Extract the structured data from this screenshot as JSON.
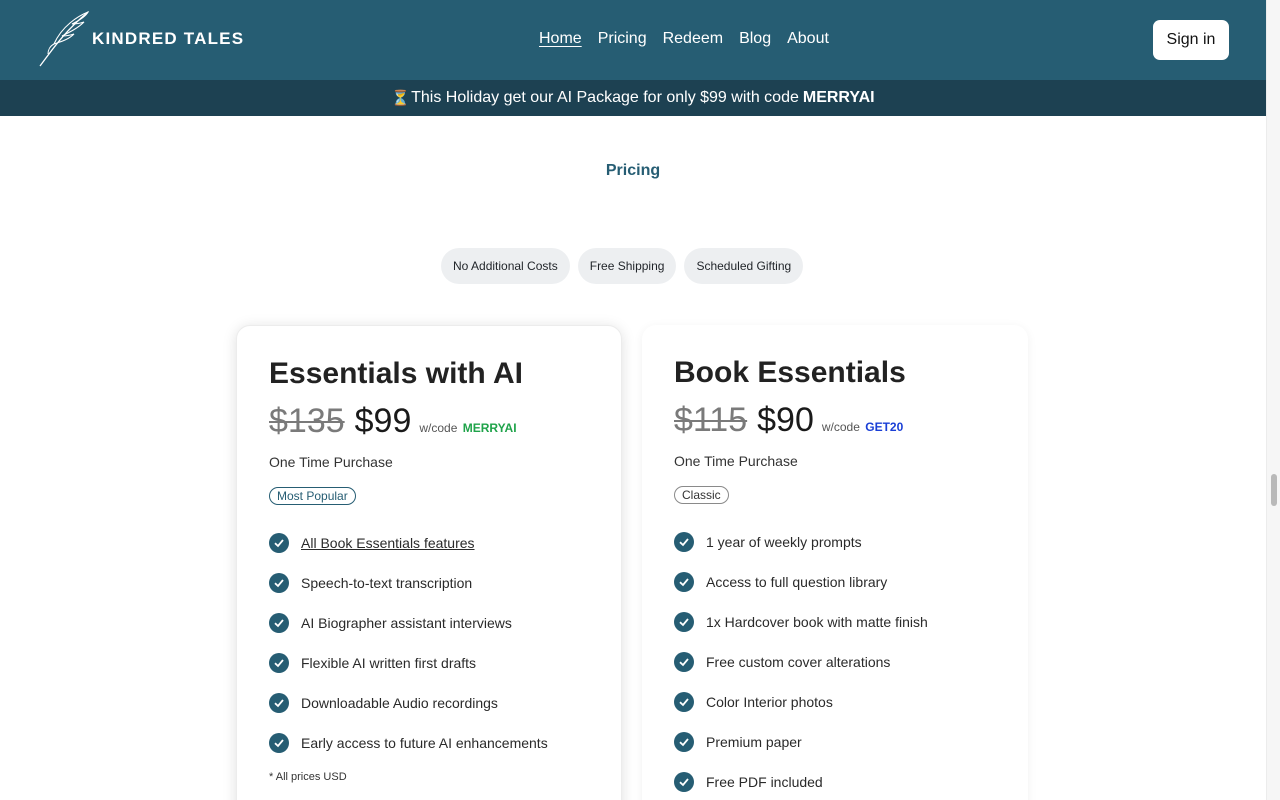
{
  "header": {
    "brand": "KINDRED TALES",
    "nav": [
      {
        "label": "Home",
        "active": true
      },
      {
        "label": "Pricing",
        "active": false
      },
      {
        "label": "Redeem",
        "active": false
      },
      {
        "label": "Blog",
        "active": false
      },
      {
        "label": "About",
        "active": false
      }
    ],
    "signin_label": "Sign in"
  },
  "promo": {
    "icon": "hourglass-icon",
    "text": "This Holiday get our AI Package for only $99 with code",
    "code": "MERRYAI"
  },
  "section_title": "Pricing",
  "chips": [
    "No Additional Costs",
    "Free Shipping",
    "Scheduled Gifting"
  ],
  "plans": [
    {
      "title": "Essentials with AI",
      "old_price": "$135",
      "new_price": "$99",
      "code_prefix": "w/code",
      "code": "MERRYAI",
      "code_color": "#1fa34a",
      "purchase_type": "One Time Purchase",
      "badge": "Most Popular",
      "features": [
        "All Book Essentials features",
        "Speech-to-text transcription",
        "AI Biographer assistant interviews",
        "Flexible AI written first drafts",
        "Downloadable Audio recordings",
        "Early access to future AI enhancements"
      ],
      "note": "* All prices USD"
    },
    {
      "title": "Book Essentials",
      "old_price": "$115",
      "new_price": "$90",
      "code_prefix": "w/code",
      "code": "GET20",
      "code_color": "#1a3fd6",
      "purchase_type": "One Time Purchase",
      "badge": "Classic",
      "features": [
        "1 year of weekly prompts",
        "Access to full question library",
        "1x Hardcover book with matte finish",
        "Free custom cover alterations",
        "Color Interior photos",
        "Premium paper",
        "Free PDF included"
      ]
    }
  ],
  "colors": {
    "header_bg": "#265d73",
    "promo_bg": "#1d4152",
    "accent": "#265d73"
  }
}
